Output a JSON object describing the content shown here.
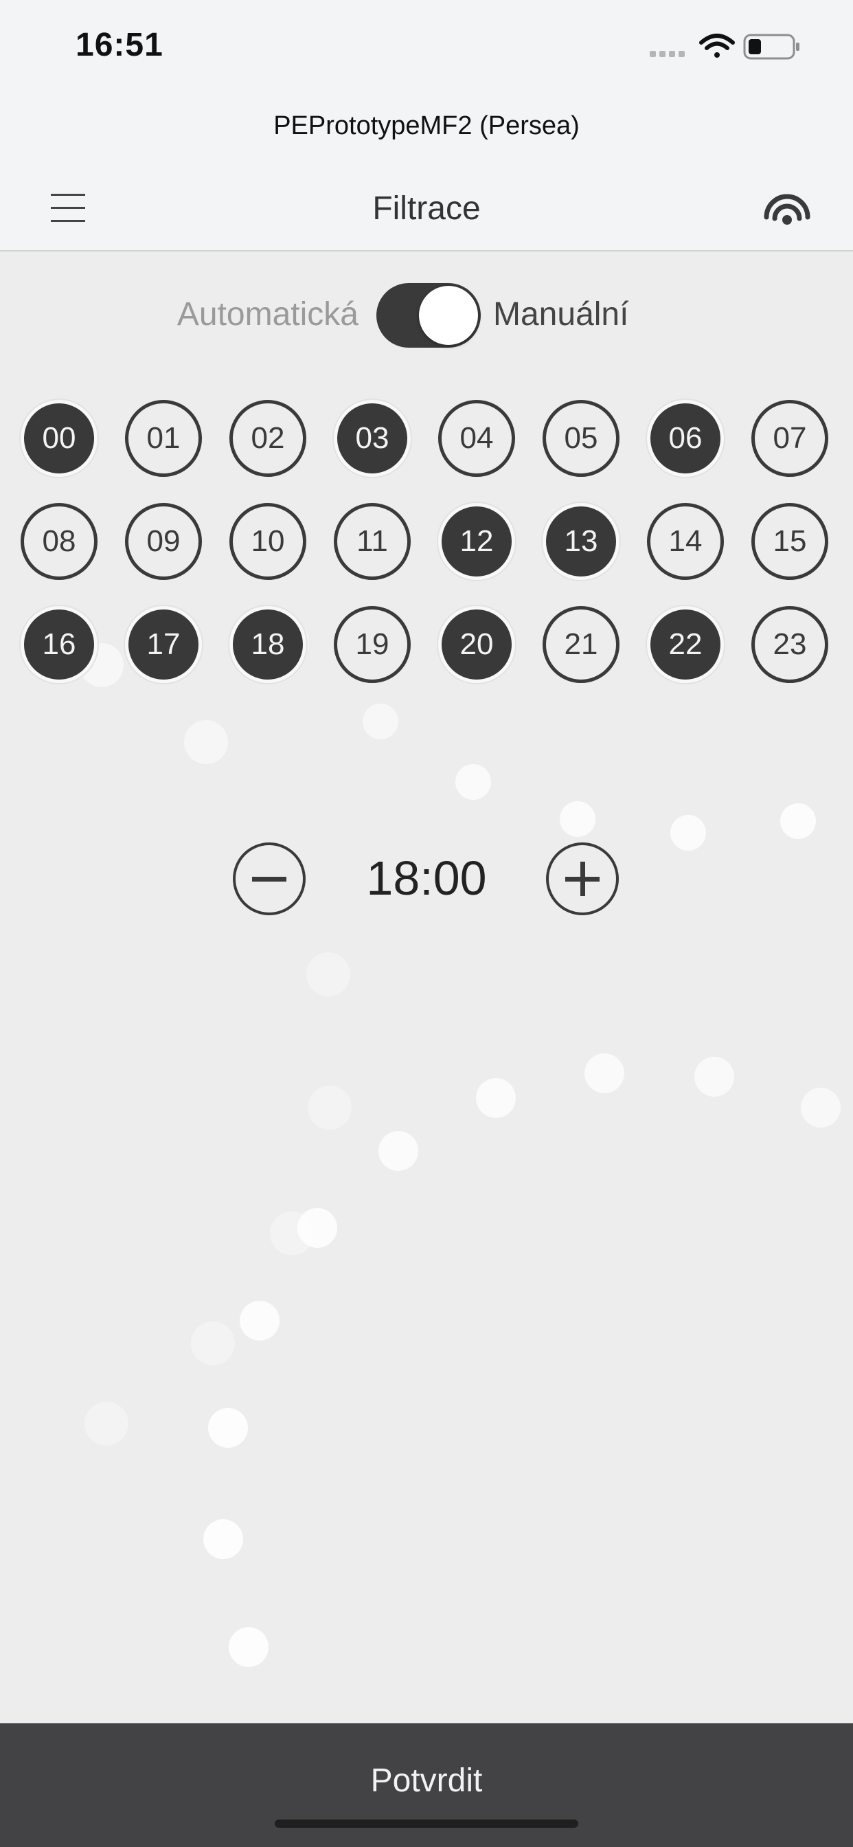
{
  "status_bar": {
    "time": "16:51",
    "icons": [
      "cellular-signal-icon",
      "wifi-icon",
      "battery-icon"
    ]
  },
  "device": {
    "name": "PEPrototypeMF2 (Persea)"
  },
  "nav": {
    "title": "Filtrace",
    "left_icon": "hamburger-menu-icon",
    "right_icon": "signal-broadcast-icon"
  },
  "mode": {
    "auto_label": "Automatická",
    "manual_label": "Manuální",
    "manual_enabled": true
  },
  "hours": [
    {
      "label": "00",
      "active": true
    },
    {
      "label": "01",
      "active": false
    },
    {
      "label": "02",
      "active": false
    },
    {
      "label": "03",
      "active": true
    },
    {
      "label": "04",
      "active": false
    },
    {
      "label": "05",
      "active": false
    },
    {
      "label": "06",
      "active": true
    },
    {
      "label": "07",
      "active": false
    },
    {
      "label": "08",
      "active": false
    },
    {
      "label": "09",
      "active": false
    },
    {
      "label": "10",
      "active": false
    },
    {
      "label": "11",
      "active": false
    },
    {
      "label": "12",
      "active": true
    },
    {
      "label": "13",
      "active": true
    },
    {
      "label": "14",
      "active": false
    },
    {
      "label": "15",
      "active": false
    },
    {
      "label": "16",
      "active": true
    },
    {
      "label": "17",
      "active": true
    },
    {
      "label": "18",
      "active": true
    },
    {
      "label": "19",
      "active": false
    },
    {
      "label": "20",
      "active": true
    },
    {
      "label": "21",
      "active": false
    },
    {
      "label": "22",
      "active": true
    },
    {
      "label": "23",
      "active": false
    }
  ],
  "time_selector": {
    "value": "18:00",
    "minus_icon": "minus-icon",
    "plus_icon": "plus-icon"
  },
  "confirm": {
    "label": "Potvrdit"
  },
  "colors": {
    "background": "#ecedec",
    "header": "#f3f4f5",
    "dark": "#39393a",
    "confirm_bar": "#434345"
  }
}
